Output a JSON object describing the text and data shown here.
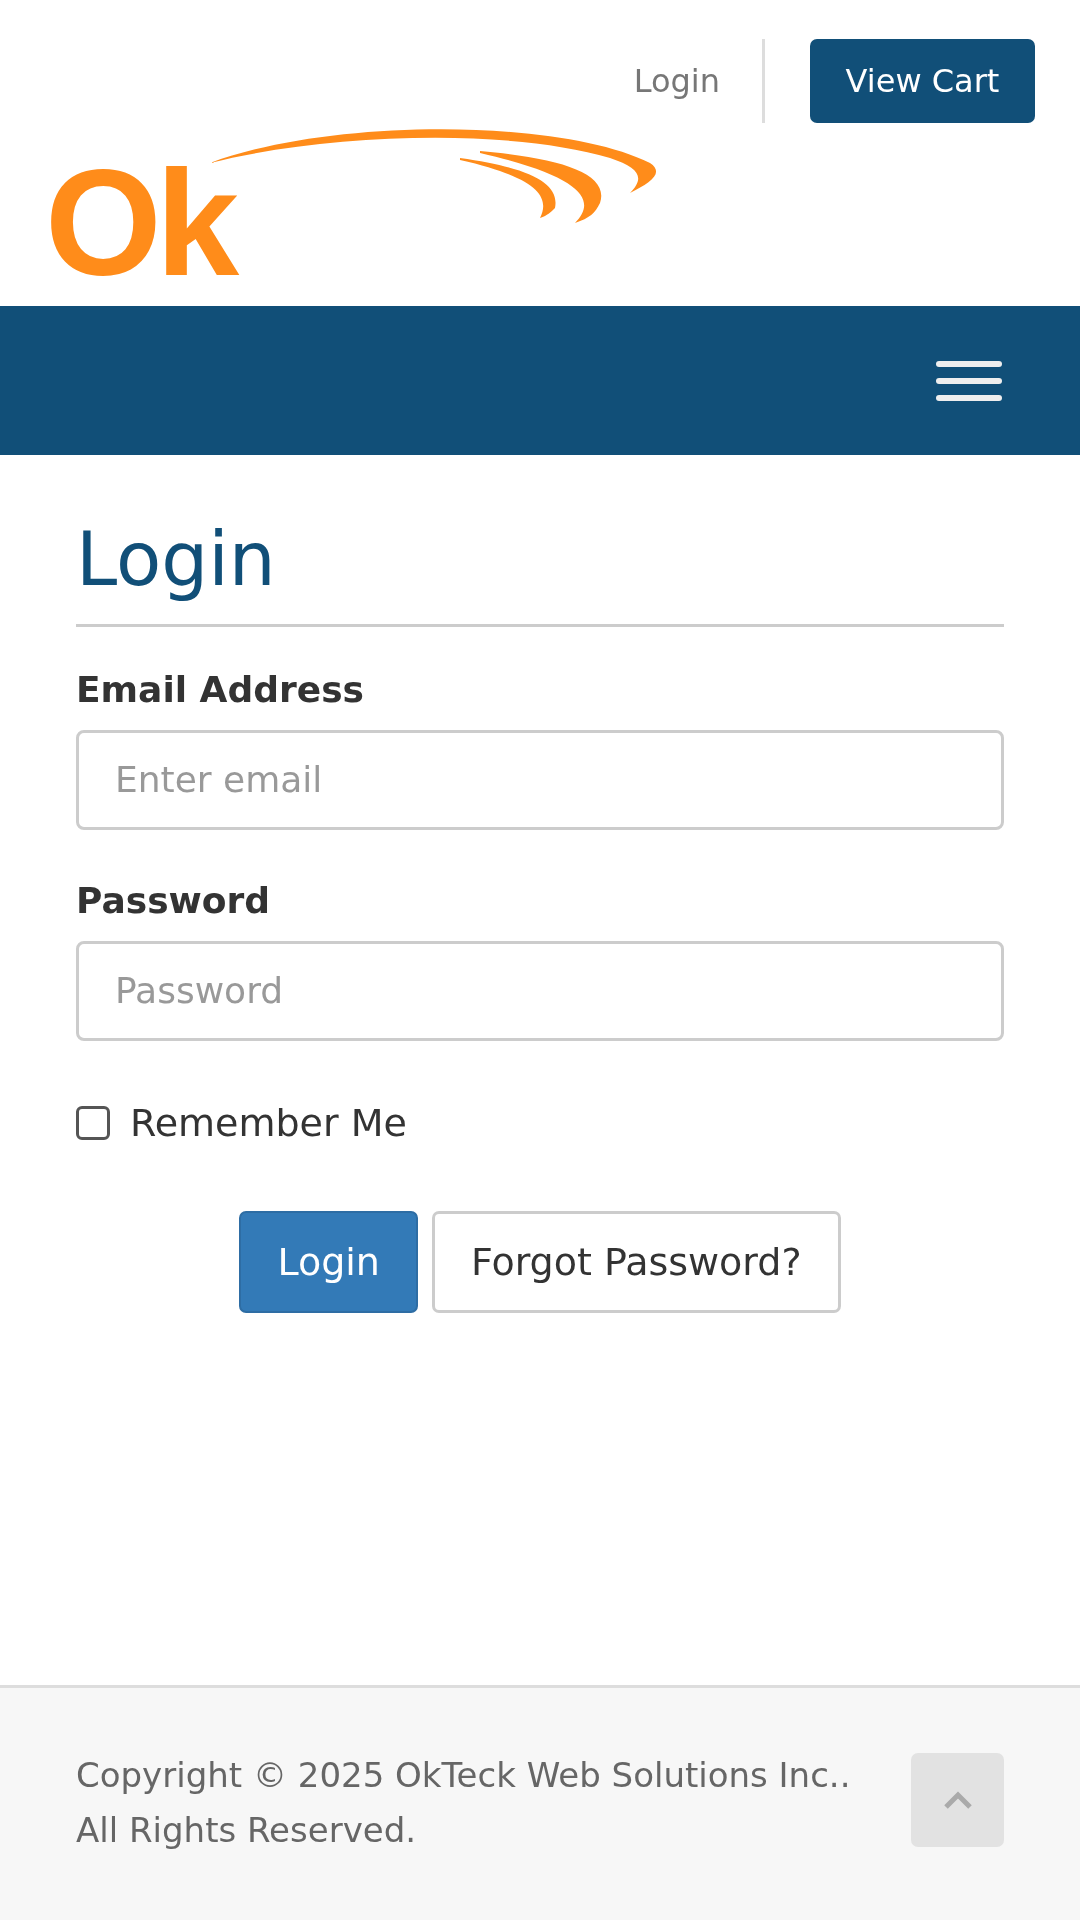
{
  "header": {
    "login_link": "Login",
    "cart_button": "View Cart",
    "logo_text": "Ok"
  },
  "form": {
    "title": "Login",
    "fields": [
      {
        "label": "Email Address",
        "placeholder": "Enter email"
      },
      {
        "label": "Password",
        "placeholder": "Password"
      }
    ],
    "remember": {
      "label": "Remember Me",
      "checked": false
    },
    "buttons": [
      {
        "label": "Login",
        "kind": "primary"
      },
      {
        "label": "Forgot Password?",
        "kind": "default"
      }
    ]
  },
  "footer": {
    "lines": [
      "Copyright © 2025 OkTeck Web Solutions Inc..",
      "All Rights Reserved."
    ]
  }
}
